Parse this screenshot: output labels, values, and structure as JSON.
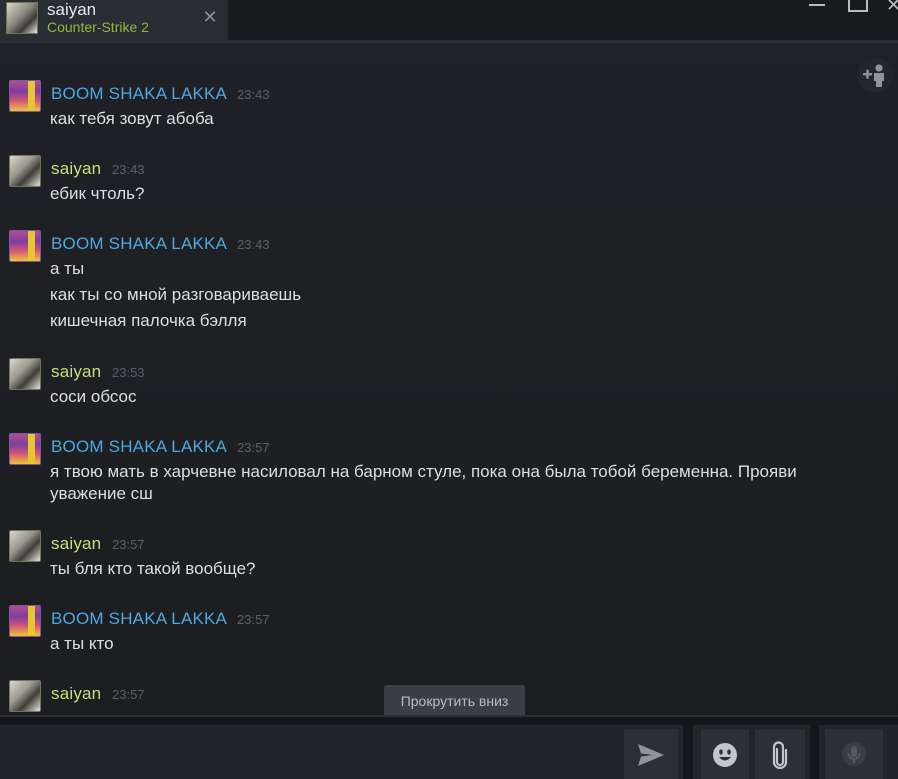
{
  "tab": {
    "name": "saiyan",
    "game": "Counter-Strike 2",
    "close_glyph": "✕"
  },
  "window_controls": {
    "close_glyph": "✕"
  },
  "messages": [
    {
      "sender": "BOOM SHAKA LAKKA",
      "time": "23:43",
      "kind": "boom",
      "lines": [
        "как тебя зовут абоба"
      ]
    },
    {
      "sender": "saiyan",
      "time": "23:43",
      "kind": "saiyan",
      "lines": [
        "ебик чтоль?"
      ]
    },
    {
      "sender": "BOOM SHAKA LAKKA",
      "time": "23:43",
      "kind": "boom",
      "lines": [
        "а ты",
        "как ты со мной разговариваешь",
        "кишечная палочка бэлля"
      ]
    },
    {
      "sender": "saiyan",
      "time": "23:53",
      "kind": "saiyan",
      "lines": [
        "соси обсос"
      ]
    },
    {
      "sender": "BOOM SHAKA LAKKA",
      "time": "23:57",
      "kind": "boom",
      "lines": [
        "я твою мать в харчевне насиловал на барном стуле, пока она была тобой беременна. Прояви",
        "уважение сш"
      ]
    },
    {
      "sender": "saiyan",
      "time": "23:57",
      "kind": "saiyan",
      "lines": [
        "ты бля кто такой вообще?"
      ]
    },
    {
      "sender": "BOOM SHAKA LAKKA",
      "time": "23:57",
      "kind": "boom",
      "lines": [
        "а ты кто"
      ]
    },
    {
      "sender": "saiyan",
      "time": "23:57",
      "kind": "saiyan",
      "lines": []
    }
  ],
  "scroll_down_label": "Прокрутить вниз",
  "composer": {
    "value": "",
    "placeholder": ""
  },
  "icons": {
    "add_friend": "add-friend-icon",
    "send": "send-icon",
    "emoji": "emoji-icon",
    "attach": "paperclip-icon",
    "voice": "microphone-icon"
  },
  "colors": {
    "boom_name": "#4fa7dd",
    "saiyan_name": "#c3e07a",
    "game_status": "#90ba3c",
    "message_text": "#dcdedf",
    "timestamp": "#5c6066",
    "background": "#1e2024"
  }
}
